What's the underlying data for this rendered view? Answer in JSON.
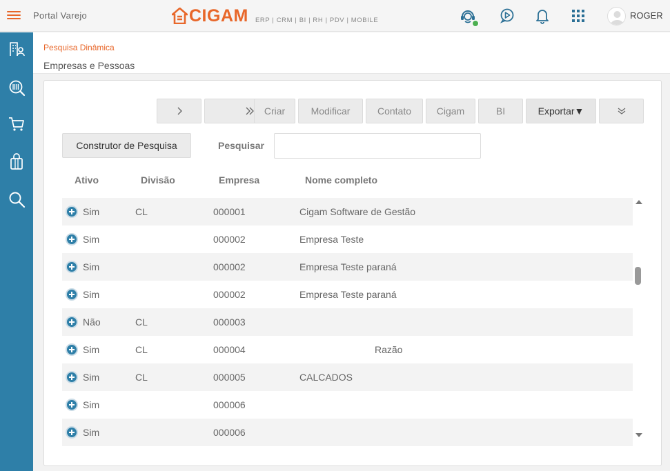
{
  "header": {
    "portal_title": "Portal Varejo",
    "logo_text": "CIGAM",
    "logo_subtitle": "ERP | CRM | BI | RH | PDV | MOBILE",
    "user_name": "ROGER",
    "icons": [
      "menu-icon",
      "support-agent-icon",
      "play-icon",
      "bell-icon",
      "apps-grid-icon",
      "user-avatar-icon"
    ],
    "colors": {
      "brand": "#e8672a",
      "sidebar": "#2e7fa8",
      "online": "#4caf50"
    }
  },
  "sidebar": {
    "items": [
      {
        "icon": "building-user-icon"
      },
      {
        "icon": "barcode-search-icon"
      },
      {
        "icon": "cart-icon"
      },
      {
        "icon": "shopping-bag-icon"
      },
      {
        "icon": "search-icon"
      }
    ]
  },
  "breadcrumb": {
    "section": "Pesquisa Dinâmica",
    "title": "Empresas e Pessoas"
  },
  "toolbar": {
    "next": ">",
    "last": "»",
    "criar": "Criar",
    "modificar": "Modificar",
    "contato": "Contato",
    "cigam": "Cigam",
    "bi": "BI",
    "exportar": "Exportar▼",
    "more": "⌄⌄"
  },
  "search": {
    "builder_label": "Construtor de Pesquisa",
    "label": "Pesquisar",
    "value": "",
    "placeholder": ""
  },
  "table": {
    "columns": [
      "Ativo",
      "Divisão",
      "Empresa",
      "Nome completo"
    ],
    "rows": [
      {
        "ativo": "Sim",
        "divisao": "CL",
        "empresa": "000001",
        "nome": "Cigam Software de Gestão"
      },
      {
        "ativo": "Sim",
        "divisao": "",
        "empresa": "000002",
        "nome": "Empresa Teste"
      },
      {
        "ativo": "Sim",
        "divisao": "",
        "empresa": "000002",
        "nome": "Empresa Teste paraná"
      },
      {
        "ativo": "Sim",
        "divisao": "",
        "empresa": "000002",
        "nome": "Empresa Teste paraná"
      },
      {
        "ativo": "Não",
        "divisao": "CL",
        "empresa": "000003",
        "nome": ""
      },
      {
        "ativo": "Sim",
        "divisao": "CL",
        "empresa": "000004",
        "nome": "Razão"
      },
      {
        "ativo": "Sim",
        "divisao": "CL",
        "empresa": "000005",
        "nome": "CALCADOS"
      },
      {
        "ativo": "Sim",
        "divisao": "",
        "empresa": "000006",
        "nome": ""
      },
      {
        "ativo": "Sim",
        "divisao": "",
        "empresa": "000006",
        "nome": ""
      }
    ]
  }
}
